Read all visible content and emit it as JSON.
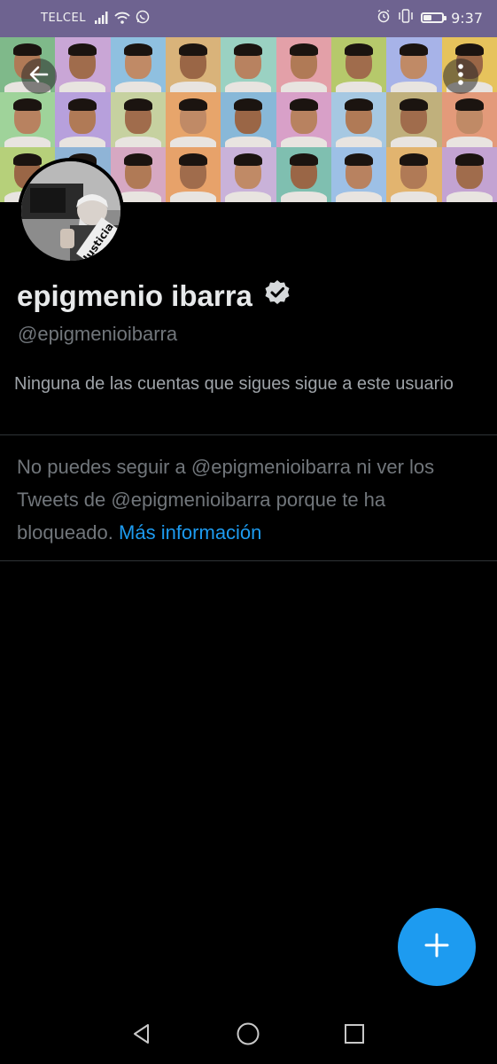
{
  "status_bar": {
    "carrier": "TELCEL",
    "time": "9:37",
    "battery_level": 0.45,
    "icons": [
      "signal-icon",
      "wifi-icon",
      "whatsapp-icon",
      "alarm-icon",
      "vibrate-icon",
      "battery-icon"
    ]
  },
  "header": {
    "back_icon": "arrow-left-icon",
    "more_icon": "more-vertical-icon"
  },
  "profile": {
    "display_name": "epigmenio ibarra",
    "verified": true,
    "handle": "@epigmenioibarra",
    "avatar_caption": "Justicia",
    "followers_note": "Ninguna de las cuentas que sigues sigue a este usuario"
  },
  "blocked": {
    "message": "No puedes seguir a @epigmenioibarra ni ver los Tweets de @epigmenioibarra porque te ha bloqueado.",
    "link_label": "Más información"
  },
  "fab": {
    "icon": "plus-icon"
  },
  "nav": {
    "icons": [
      "back-triangle-icon",
      "home-circle-icon",
      "recents-square-icon"
    ]
  },
  "colors": {
    "status_bar": "#6e6390",
    "accent": "#1d9bf0",
    "background": "#000000",
    "secondary_text": "#71767b"
  }
}
